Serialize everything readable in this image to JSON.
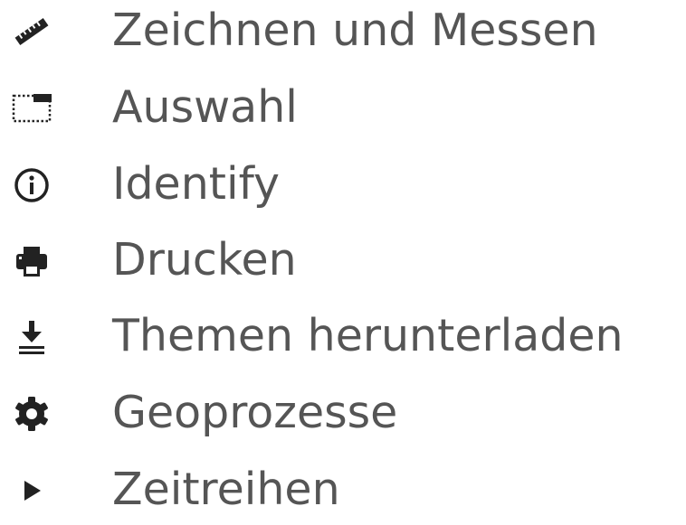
{
  "menu": {
    "items": [
      {
        "label": "Zeichnen und Messen",
        "icon": "ruler-icon"
      },
      {
        "label": "Auswahl",
        "icon": "selection-icon"
      },
      {
        "label": "Identify",
        "icon": "info-icon"
      },
      {
        "label": "Drucken",
        "icon": "print-icon"
      },
      {
        "label": "Themen herunterladen",
        "icon": "download-icon"
      },
      {
        "label": "Geoprozesse",
        "icon": "gear-icon"
      },
      {
        "label": "Zeitreihen",
        "icon": "play-icon"
      }
    ]
  },
  "colors": {
    "text": "#555555",
    "icon": "#222222",
    "background": "#ffffff"
  }
}
